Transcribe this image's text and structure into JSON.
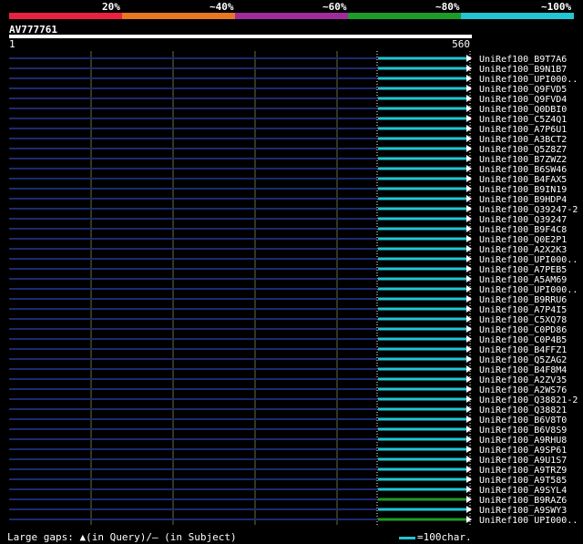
{
  "legend": {
    "labels": [
      "20%",
      "~40%",
      "~60%",
      "~80%",
      "~100%"
    ],
    "colors": [
      "#e8223f",
      "#e87722",
      "#a02c9c",
      "#1f9b2a",
      "#21c6d2"
    ]
  },
  "query": {
    "title": "AV777761",
    "start_label": "1",
    "end_label": "560",
    "length": 560
  },
  "hits": [
    {
      "name": "UniRef100_B9T7A6",
      "identity": 100
    },
    {
      "name": "UniRef100_B9N1B7",
      "identity": 100
    },
    {
      "name": "UniRef100_UPI000..",
      "identity": 100
    },
    {
      "name": "UniRef100_Q9FVD5",
      "identity": 100
    },
    {
      "name": "UniRef100_Q9FVD4",
      "identity": 100
    },
    {
      "name": "UniRef100_Q0DBI0",
      "identity": 100
    },
    {
      "name": "UniRef100_C5Z4Q1",
      "identity": 100
    },
    {
      "name": "UniRef100_A7P6U1",
      "identity": 100
    },
    {
      "name": "UniRef100_A3BCT2",
      "identity": 100
    },
    {
      "name": "UniRef100_Q5Z8Z7",
      "identity": 100
    },
    {
      "name": "UniRef100_B7ZWZ2",
      "identity": 100
    },
    {
      "name": "UniRef100_B6SW46",
      "identity": 100
    },
    {
      "name": "UniRef100_B4FAX5",
      "identity": 100
    },
    {
      "name": "UniRef100_B9IN19",
      "identity": 100
    },
    {
      "name": "UniRef100_B9HDP4",
      "identity": 100
    },
    {
      "name": "UniRef100_Q39247-2",
      "identity": 100
    },
    {
      "name": "UniRef100_Q39247",
      "identity": 100
    },
    {
      "name": "UniRef100_B9F4C8",
      "identity": 100
    },
    {
      "name": "UniRef100_Q0E2P1",
      "identity": 100
    },
    {
      "name": "UniRef100_A2X2K3",
      "identity": 100
    },
    {
      "name": "UniRef100_UPI000..",
      "identity": 100
    },
    {
      "name": "UniRef100_A7PEB5",
      "identity": 100
    },
    {
      "name": "UniRef100_A5AM69",
      "identity": 100
    },
    {
      "name": "UniRef100_UPI000..",
      "identity": 100
    },
    {
      "name": "UniRef100_B9RRU6",
      "identity": 100
    },
    {
      "name": "UniRef100_A7P4I5",
      "identity": 100
    },
    {
      "name": "UniRef100_C5XQ78",
      "identity": 100
    },
    {
      "name": "UniRef100_C0PD86",
      "identity": 100
    },
    {
      "name": "UniRef100_C0P4B5",
      "identity": 100
    },
    {
      "name": "UniRef100_B4FFZ1",
      "identity": 100
    },
    {
      "name": "UniRef100_Q5ZAG2",
      "identity": 100
    },
    {
      "name": "UniRef100_B4F8M4",
      "identity": 100
    },
    {
      "name": "UniRef100_A2ZV35",
      "identity": 100
    },
    {
      "name": "UniRef100_A2WS76",
      "identity": 100
    },
    {
      "name": "UniRef100_Q38821-2",
      "identity": 100
    },
    {
      "name": "UniRef100_Q38821",
      "identity": 100
    },
    {
      "name": "UniRef100_B6V8T0",
      "identity": 100
    },
    {
      "name": "UniRef100_B6V8S9",
      "identity": 100
    },
    {
      "name": "UniRef100_A9RHU8",
      "identity": 100
    },
    {
      "name": "UniRef100_A9SP61",
      "identity": 100
    },
    {
      "name": "UniRef100_A9U1S7",
      "identity": 100
    },
    {
      "name": "UniRef100_A9TRZ9",
      "identity": 100
    },
    {
      "name": "UniRef100_A9T585",
      "identity": 100
    },
    {
      "name": "UniRef100_A9SYL4",
      "identity": 100
    },
    {
      "name": "UniRef100_B9RAZ6",
      "identity": 80
    },
    {
      "name": "UniRef100_A9SWY3",
      "identity": 100
    },
    {
      "name": "UniRef100_UPI000..",
      "identity": 80
    }
  ],
  "footer": {
    "gaps_text": "Large gaps: ▲(in Query)/– (in Subject)",
    "scale_text": "=100char."
  }
}
